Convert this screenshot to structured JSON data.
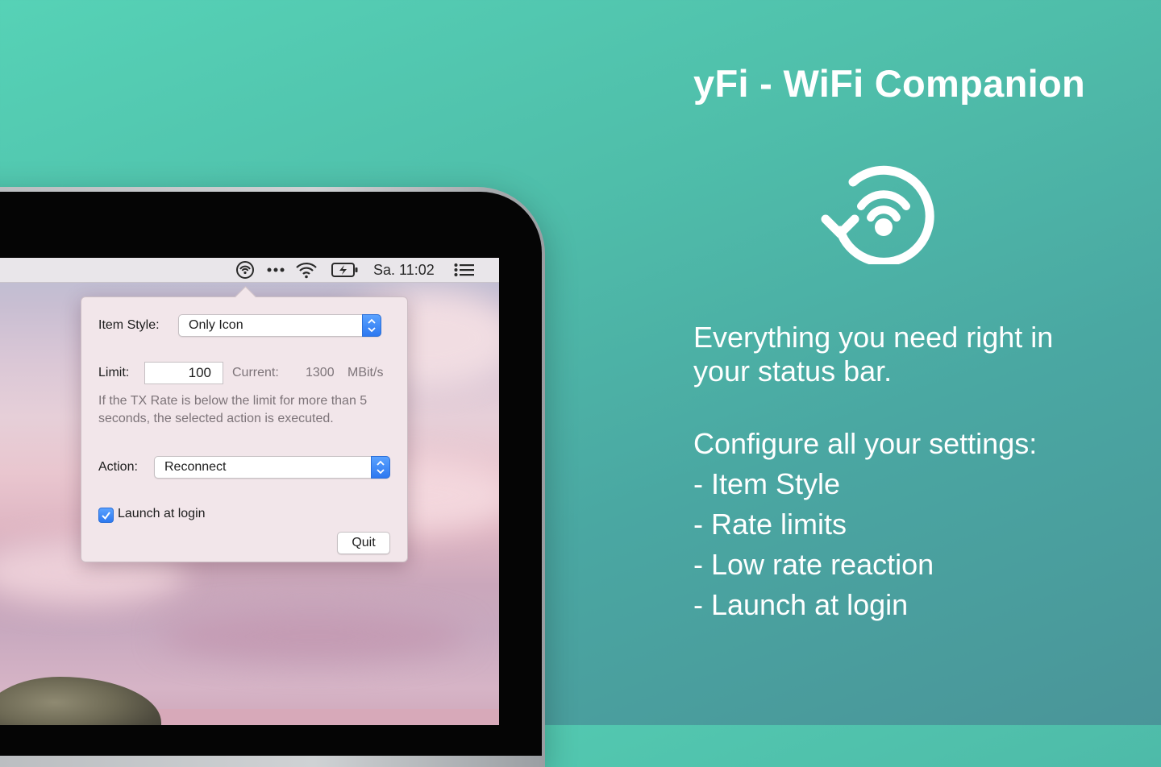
{
  "hero": {
    "title": "yFi - WiFi Companion",
    "tagline": "Everything you need right in your status bar.",
    "config_heading": "Configure all your settings:",
    "features": [
      "- Item Style",
      "- Rate limits",
      "- Low rate reaction",
      "- Launch at login"
    ]
  },
  "menubar": {
    "icons": [
      "yfi-status-icon",
      "more-icon",
      "wifi-icon",
      "battery-charging-icon",
      "notification-center-icon"
    ],
    "clock": "Sa. 11:02"
  },
  "popover": {
    "item_style_label": "Item Style:",
    "item_style_value": "Only Icon",
    "limit_label": "Limit:",
    "limit_value": "100",
    "current_label": "Current:",
    "current_value": "1300",
    "unit": "MBit/s",
    "help_text": "If the TX Rate is below the limit for more than 5 seconds, the selected action is executed.",
    "action_label": "Action:",
    "action_value": "Reconnect",
    "launch_label": "Launch at login",
    "launch_checked": true,
    "quit_label": "Quit"
  },
  "colors": {
    "background_top": "#56d2b6",
    "background_bottom": "#4a9599",
    "accent_blue": "#2d78f0",
    "text_white": "#ffffff"
  }
}
